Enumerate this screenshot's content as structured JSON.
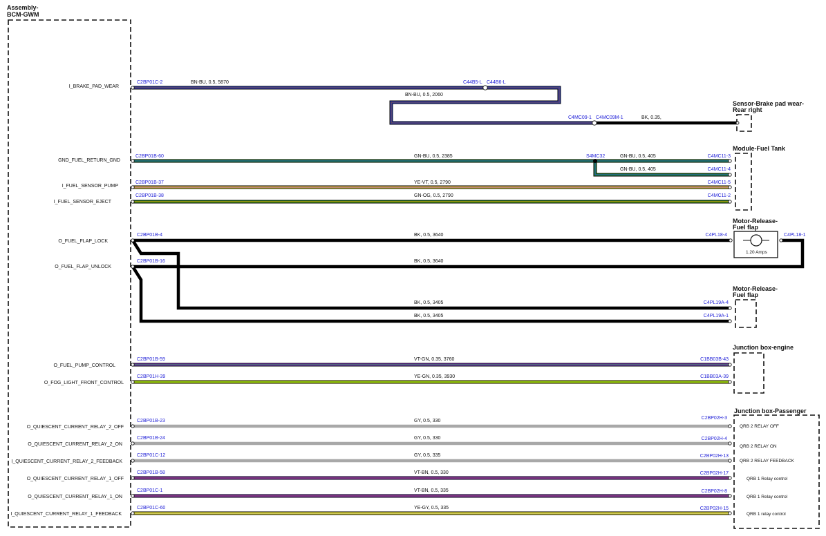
{
  "components": {
    "bcm": {
      "line1": "Assembly-",
      "line2": "BCM-GWM"
    },
    "brake_sensor": {
      "line1": "Sensor-Brake pad wear-",
      "line2": "Rear right"
    },
    "fuel_tank": {
      "line1": "Module-Fuel Tank"
    },
    "flap_motor_1": {
      "line1": "Motor-Release-",
      "line2": "Fuel flap",
      "current": "1.20 Amps"
    },
    "flap_motor_2": {
      "line1": "Motor-Release-",
      "line2": "Fuel flap"
    },
    "jb_engine": {
      "line1": "Junction box-engine"
    },
    "jb_passenger": {
      "line1": "Junction box-Passenger"
    }
  },
  "signals": [
    "I_BRAKE_PAD_WEAR",
    "GND_FUEL_RETURN_GND",
    "I_FUEL_SENSOR_PUMP",
    "I_FUEL_SENSOR_EJECT",
    "O_FUEL_FLAP_LOCK",
    "O_FUEL_FLAP_UNLOCK",
    "O_FUEL_PUMP_CONTROL",
    "O_FOG_LIGHT_FRONT_CONTROL",
    "O_QUIESCENT_CURRENT_RELAY_2_OFF",
    "O_QUIESCENT_CURRENT_RELAY_2_ON",
    "I_QUIESCENT_CURRENT_RELAY_2_FEEDBACK",
    "O_QUIESCENT_CURRENT_RELAY_1_OFF",
    "O_QUIESCENT_CURRENT_RELAY_1_ON",
    "I_QUIESCENT_CURRENT_RELAY_1_FEEDBACK"
  ],
  "connectors": {
    "brake_src": "C2BP01C-2",
    "brake_mid": "C44B5-L",
    "brake_mid2": "C44B6-L",
    "brake_mid3": "C4MC09-1",
    "brake_mid4": "C4MC09M-1",
    "gnd_src": "C2BP01B-60",
    "splice": "S4MC32",
    "tank_3": "C4MC11-3",
    "tank_4": "C4MC11-4",
    "pump_src": "C2BP01B-37",
    "tank_5": "C4MC11-5",
    "eject_src": "C2BP01B-38",
    "tank_2": "C4MC11-2",
    "lock_src": "C2BP01B-4",
    "flap18_4": "C4PL18-4",
    "flap18_1": "C4PL18-1",
    "unlock_src": "C2BP01B-16",
    "flap19_4": "C4PL19A-4",
    "flap19_1": "C4PL19A-1",
    "pumpctl_src": "C2BP01B-59",
    "jbe_43": "C1BB03B-43",
    "fog_src": "C2BP01H-39",
    "jbe_39": "C1BB03A-39",
    "q2off_src": "C2BP01B-23",
    "jbp_3": "C2BP02H-3",
    "q2on_src": "C2BP01B-24",
    "jbp_4": "C2BP02H-4",
    "q2fb_src": "C2BP01C-12",
    "jbp_13": "C2BP02H-13",
    "q1off_src": "C2BP01B-58",
    "jbp_17": "C2BP02H-17",
    "q1on_src": "C2BP01C-1",
    "jbp_8": "C2BP02H-8",
    "q1fb_src": "C2BP01C-60",
    "jbp_15": "C2BP02H-15"
  },
  "wires": {
    "brake_1": "BN-BU,  0.5,  5870",
    "brake_2": "BN-BU,  0.5,  2060",
    "brake_3": "BK,  0.35,",
    "gnd_1": "GN-BU,  0.5,  2385",
    "gnd_2": "GN-BU,  0.5,  405",
    "gnd_3": "GN-BU,  0.5,  405",
    "pump": "YE-VT,  0.5,  2790",
    "eject": "GN-OG,  0.5,  2790",
    "lock": "BK,  0.5,  3640",
    "unlock": "BK,  0.5,  3640",
    "flap2_a": "BK,  0.5,  3405",
    "flap2_b": "BK,  0.5,  3405",
    "pumpctl": "VT-GN,  0.35,  3760",
    "fog": "YE-GN,  0.35,  3930",
    "q2off": "GY,  0.5,  330",
    "q2on": "GY,  0.5,  330",
    "q2fb": "GY,  0.5,  335",
    "q1off": "VT-BN,  0.5,  330",
    "q1on": "VT-BN,  0.5,  335",
    "q1fb": "YE-GY,  0.5,  335"
  },
  "jb_passenger_pins": [
    "QRB 2 RELAY OFF",
    "QRB 2 RELAY ON",
    "QRB 2 RELAY FEEDBACK",
    "QRB 1 Relay control",
    "QRB 1 Relay control",
    "QRB 1 relay control"
  ],
  "colors": {
    "BN": "#7a4a1e",
    "BU": "#2a3fd6",
    "BK": "#000000",
    "GN": "#1f9a1f",
    "YE": "#f2e800",
    "VT": "#8a2be2",
    "OG": "#f08a00",
    "GY": "#a8a8a8",
    "connector_text": "#2323d8"
  }
}
